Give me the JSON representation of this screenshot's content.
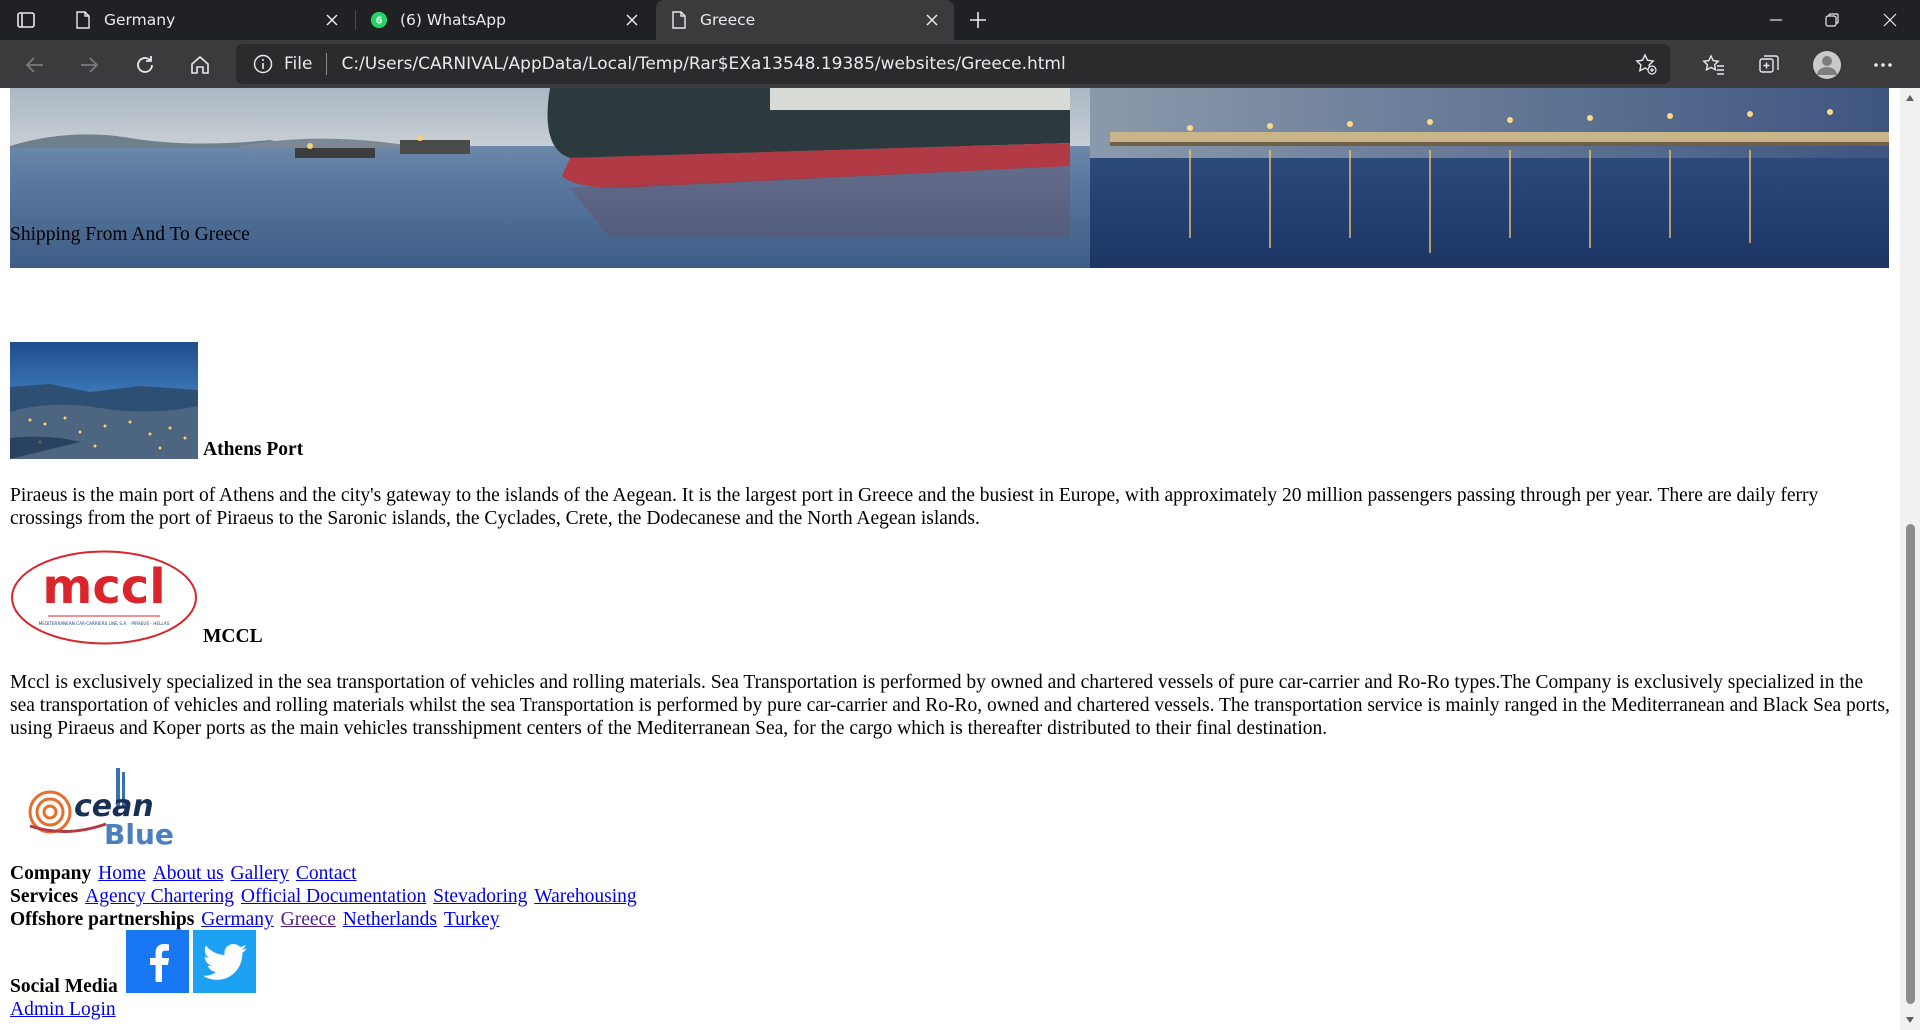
{
  "browser": {
    "tabs": [
      {
        "label": "Germany",
        "icon": "page-icon",
        "active": false
      },
      {
        "label": "(6) WhatsApp",
        "icon": "whatsapp-icon",
        "badge": "6",
        "active": false
      },
      {
        "label": "Greece",
        "icon": "page-icon",
        "active": true
      }
    ],
    "address": {
      "scheme": "File",
      "url": "C:/Users/CARNIVAL/AppData/Local/Temp/Rar$EXa13548.19385/websites/Greece.html"
    },
    "colors": {
      "frame": "#202124",
      "toolbar": "#3b3b3d",
      "text": "#e8eaed"
    }
  },
  "page": {
    "hero_caption": "Shipping From And To Greece",
    "sections": [
      {
        "title": "Athens Port",
        "body": "Piraeus is the main port of Athens and the city's gateway to the islands of the Aegean. It is the largest port in Greece and the busiest in Europe, with approximately 20 million passengers passing through per year. There are daily ferry crossings from the port of Piraeus to the Saronic islands, the Cyclades, Crete, the Dodecanese and the North Aegean islands."
      },
      {
        "title": "MCCL",
        "logo_text": "mccl",
        "logo_subtext": "MEDITERRANEAN CAR-CARRIERS LINE S.A. · PIRAEUS - HELLAS",
        "body": "Mccl is exclusively specialized in the sea transportation of vehicles and rolling materials. Sea Transportation is performed by owned and chartered vessels of pure car-carrier and Ro-Ro types.The Company is exclusively specialized in the sea transportation of vehicles and rolling materials whilst the sea Transportation is performed by pure car-carrier and Ro-Ro, owned and chartered vessels. The transportation service is mainly ranged in the Mediterranean and Black Sea ports, using Piraeus and Koper ports as the main vehicles transshipment centers of the Mediterranean Sea, for the cargo which is thereafter distributed to their final destination."
      }
    ],
    "footer": {
      "logo_text_top": "cean",
      "logo_text_bottom": "Blue",
      "company_label": "Company",
      "company_links": [
        "Home",
        "About us",
        "Gallery",
        "Contact"
      ],
      "services_label": "Services",
      "services_links": [
        "Agency Chartering",
        "Official Documentation",
        "Stevadoring",
        "Warehousing"
      ],
      "offshore_label": "Offshore partnerships",
      "offshore_links": [
        "Germany",
        "Greece",
        "Netherlands",
        "Turkey"
      ],
      "social_label": "Social Media",
      "social": [
        {
          "name": "facebook",
          "color": "#1877f2"
        },
        {
          "name": "twitter",
          "color": "#1da1f2"
        }
      ],
      "admin_link": "Admin Login"
    }
  }
}
